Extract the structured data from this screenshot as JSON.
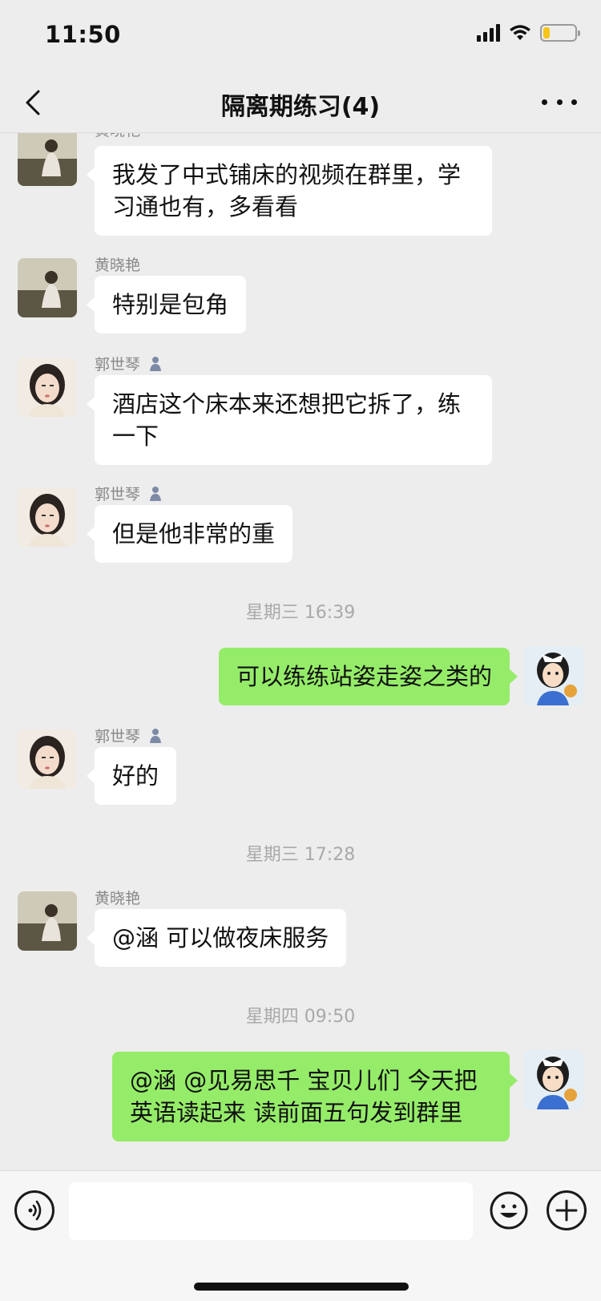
{
  "status_bar": {
    "time": "11:50",
    "battery_level": 0.2,
    "battery_color": "#f5c518"
  },
  "header": {
    "title": "隔离期练习(4)"
  },
  "colors": {
    "background": "#ededed",
    "incoming_bubble": "#ffffff",
    "outgoing_bubble": "#95ec69",
    "sender_name": "#888888"
  },
  "messages": [
    {
      "sender": "黄晓艳",
      "text_lines": [
        "我发了中式铺床的视频在群里，学",
        "习通也有，多看看"
      ]
    },
    {
      "sender": "黄晓艳",
      "text": "特别是包角"
    },
    {
      "sender": "郭世琴",
      "text_lines": [
        "酒店这个床本来还想把它拆了，练",
        "一下"
      ]
    },
    {
      "sender": "郭世琴",
      "text": "但是他非常的重"
    },
    {
      "timestamp": "星期三 16:39"
    },
    {
      "text": "可以练练站姿走姿之类的"
    },
    {
      "sender": "郭世琴",
      "text": "好的"
    },
    {
      "timestamp": "星期三 17:28"
    },
    {
      "sender": "黄晓艳",
      "text": "@涵 可以做夜床服务"
    },
    {
      "timestamp": "星期四 09:50"
    },
    {
      "text_lines": [
        "@涵 @见易思千 宝贝儿们 今天把",
        "英语读起来 读前面五句发到群里"
      ]
    }
  ],
  "input_bar": {
    "voice_icon": "voice-icon",
    "emoji_icon": "emoji-icon",
    "plus_icon": "plus-icon"
  }
}
